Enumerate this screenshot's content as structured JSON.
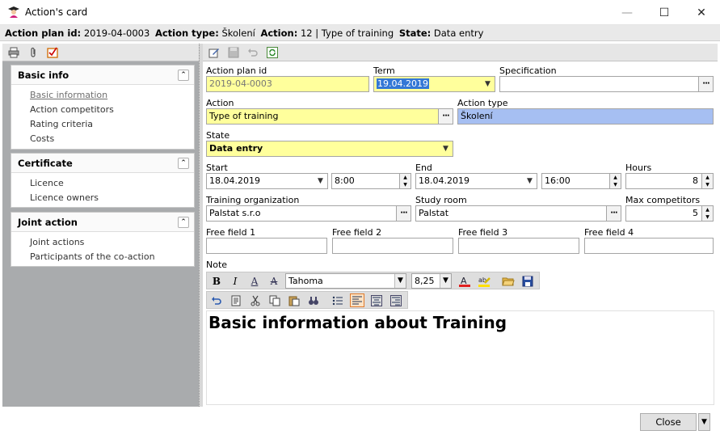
{
  "window": {
    "title": "Action's card",
    "min_glyph": "—",
    "max_glyph": "☐",
    "close_glyph": "✕"
  },
  "info": {
    "plan_id_label": "Action plan id:",
    "plan_id": "2019-04-0003",
    "type_label": "Action type:",
    "type": "Školení",
    "action_label": "Action:",
    "action": "12 | Type of training",
    "state_label": "State:",
    "state": "Data entry"
  },
  "sidebar": {
    "groups": [
      {
        "title": "Basic info",
        "items": [
          "Basic information",
          "Action competitors",
          "Rating criteria",
          "Costs"
        ]
      },
      {
        "title": "Certificate",
        "items": [
          "Licence",
          "Licence owners"
        ]
      },
      {
        "title": "Joint action",
        "items": [
          "Joint actions",
          "Participants of the co-action"
        ]
      }
    ]
  },
  "form": {
    "plan_id": {
      "label": "Action plan id",
      "value": "2019-04-0003"
    },
    "term": {
      "label": "Term",
      "value": "19.04.2019"
    },
    "specification": {
      "label": "Specification",
      "value": ""
    },
    "action": {
      "label": "Action",
      "value": "Type of training"
    },
    "action_type": {
      "label": "Action type",
      "value": "Školení"
    },
    "state": {
      "label": "State",
      "value": "Data entry"
    },
    "start": {
      "label": "Start",
      "date": "18.04.2019",
      "time": "8:00"
    },
    "end": {
      "label": "End",
      "date": "18.04.2019",
      "time": "16:00"
    },
    "hours": {
      "label": "Hours",
      "value": "8"
    },
    "training_org": {
      "label": "Training organization",
      "value": "Palstat s.r.o"
    },
    "study_room": {
      "label": "Study room",
      "value": "Palstat"
    },
    "max_competitors": {
      "label": "Max competitors",
      "value": "5"
    },
    "free1": {
      "label": "Free field 1",
      "value": ""
    },
    "free2": {
      "label": "Free field 2",
      "value": ""
    },
    "free3": {
      "label": "Free field 3",
      "value": ""
    },
    "free4": {
      "label": "Free field 4",
      "value": ""
    },
    "note": {
      "label": "Note",
      "content": "Basic information about Training",
      "font": "Tahoma",
      "size": "8,25"
    }
  },
  "footer": {
    "close_label": "Close"
  },
  "colors": {
    "required": "#ffff9c",
    "readonly_blue": "#a6bff2",
    "sidebar_bg": "#a9abad"
  }
}
